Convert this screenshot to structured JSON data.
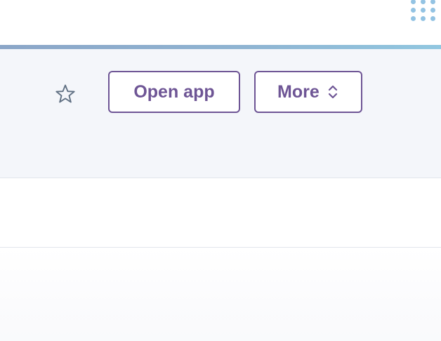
{
  "header": {
    "open_app_label": "Open app",
    "more_label": "More"
  },
  "icons": {
    "star": "star-outline-icon",
    "chevron": "chevron-up-down-icon",
    "apps": "apps-grid-icon"
  },
  "colors": {
    "accent": "#6e5595",
    "icon_gray": "#5f6f82",
    "grid_dots": "#93c3e3",
    "panel_bg": "#f4f6fa"
  }
}
